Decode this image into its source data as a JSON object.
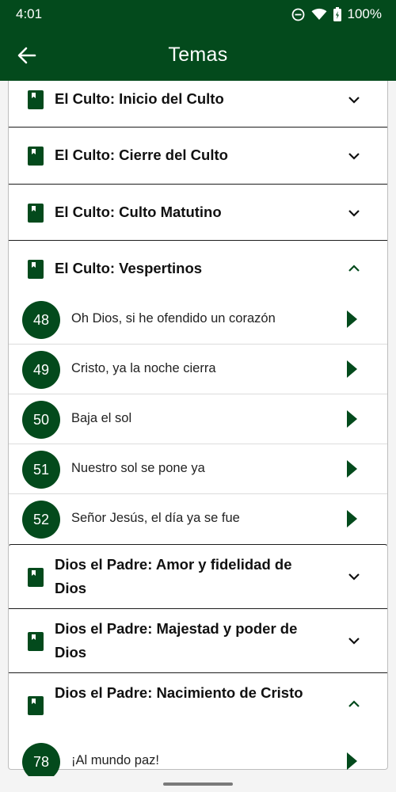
{
  "status": {
    "time": "4:01",
    "battery": "100%"
  },
  "header": {
    "title": "Temas"
  },
  "categories": [
    {
      "title": "El Culto: Inicio del Culto",
      "expanded": false
    },
    {
      "title": "El Culto: Cierre del Culto",
      "expanded": false
    },
    {
      "title": "El Culto: Culto Matutino",
      "expanded": false
    },
    {
      "title": "El Culto: Vespertinos",
      "expanded": true,
      "songs": [
        {
          "number": "48",
          "title": "Oh Dios, si he ofendido un corazón"
        },
        {
          "number": "49",
          "title": "Cristo, ya la noche cierra"
        },
        {
          "number": "50",
          "title": "Baja el sol"
        },
        {
          "number": "51",
          "title": "Nuestro sol se pone ya"
        },
        {
          "number": "52",
          "title": "Señor Jesús, el día ya se fue"
        }
      ]
    },
    {
      "title": "Dios el Padre: Amor y fidelidad de Dios",
      "expanded": false
    },
    {
      "title": "Dios el Padre: Majestad y poder de Dios",
      "expanded": false
    },
    {
      "title": "Dios el Padre: Nacimiento de Cristo",
      "expanded": true,
      "songs": [
        {
          "number": "78",
          "title": "¡Al mundo paz!"
        }
      ]
    }
  ],
  "colors": {
    "primary": "#034a1c",
    "background": "#f4f4f4"
  },
  "icons": {
    "back": "arrow-left-icon",
    "category": "book-icon",
    "collapsed": "chevron-down-icon",
    "expanded": "chevron-up-icon",
    "open": "play-arrow-icon"
  }
}
